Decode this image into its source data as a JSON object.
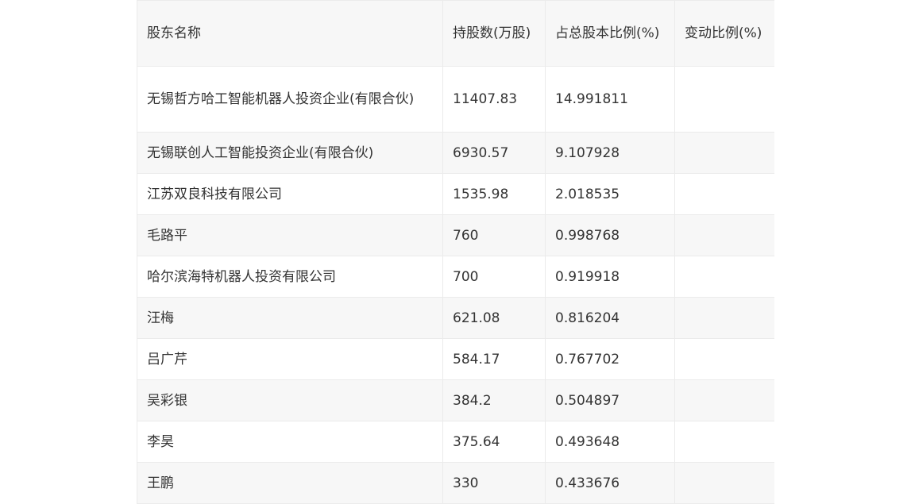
{
  "table": {
    "headers": [
      "股东名称",
      "持股数(万股)",
      "占总股本比例(%)",
      "变动比例(%)"
    ],
    "rows": [
      {
        "name": "无锡哲方哈工智能机器人投资企业(有限合伙)",
        "shares": "11407.83",
        "ratio": "14.991811",
        "change": ""
      },
      {
        "name": "无锡联创人工智能投资企业(有限合伙)",
        "shares": "6930.57",
        "ratio": "9.107928",
        "change": ""
      },
      {
        "name": "江苏双良科技有限公司",
        "shares": "1535.98",
        "ratio": "2.018535",
        "change": ""
      },
      {
        "name": "毛路平",
        "shares": "760",
        "ratio": "0.998768",
        "change": ""
      },
      {
        "name": "哈尔滨海特机器人投资有限公司",
        "shares": "700",
        "ratio": "0.919918",
        "change": ""
      },
      {
        "name": "汪梅",
        "shares": "621.08",
        "ratio": "0.816204",
        "change": ""
      },
      {
        "name": "吕广芹",
        "shares": "584.17",
        "ratio": "0.767702",
        "change": ""
      },
      {
        "name": "吴彩银",
        "shares": "384.2",
        "ratio": "0.504897",
        "change": ""
      },
      {
        "name": "李昊",
        "shares": "375.64",
        "ratio": "0.493648",
        "change": ""
      },
      {
        "name": "王鹏",
        "shares": "330",
        "ratio": "0.433676",
        "change": ""
      }
    ]
  }
}
